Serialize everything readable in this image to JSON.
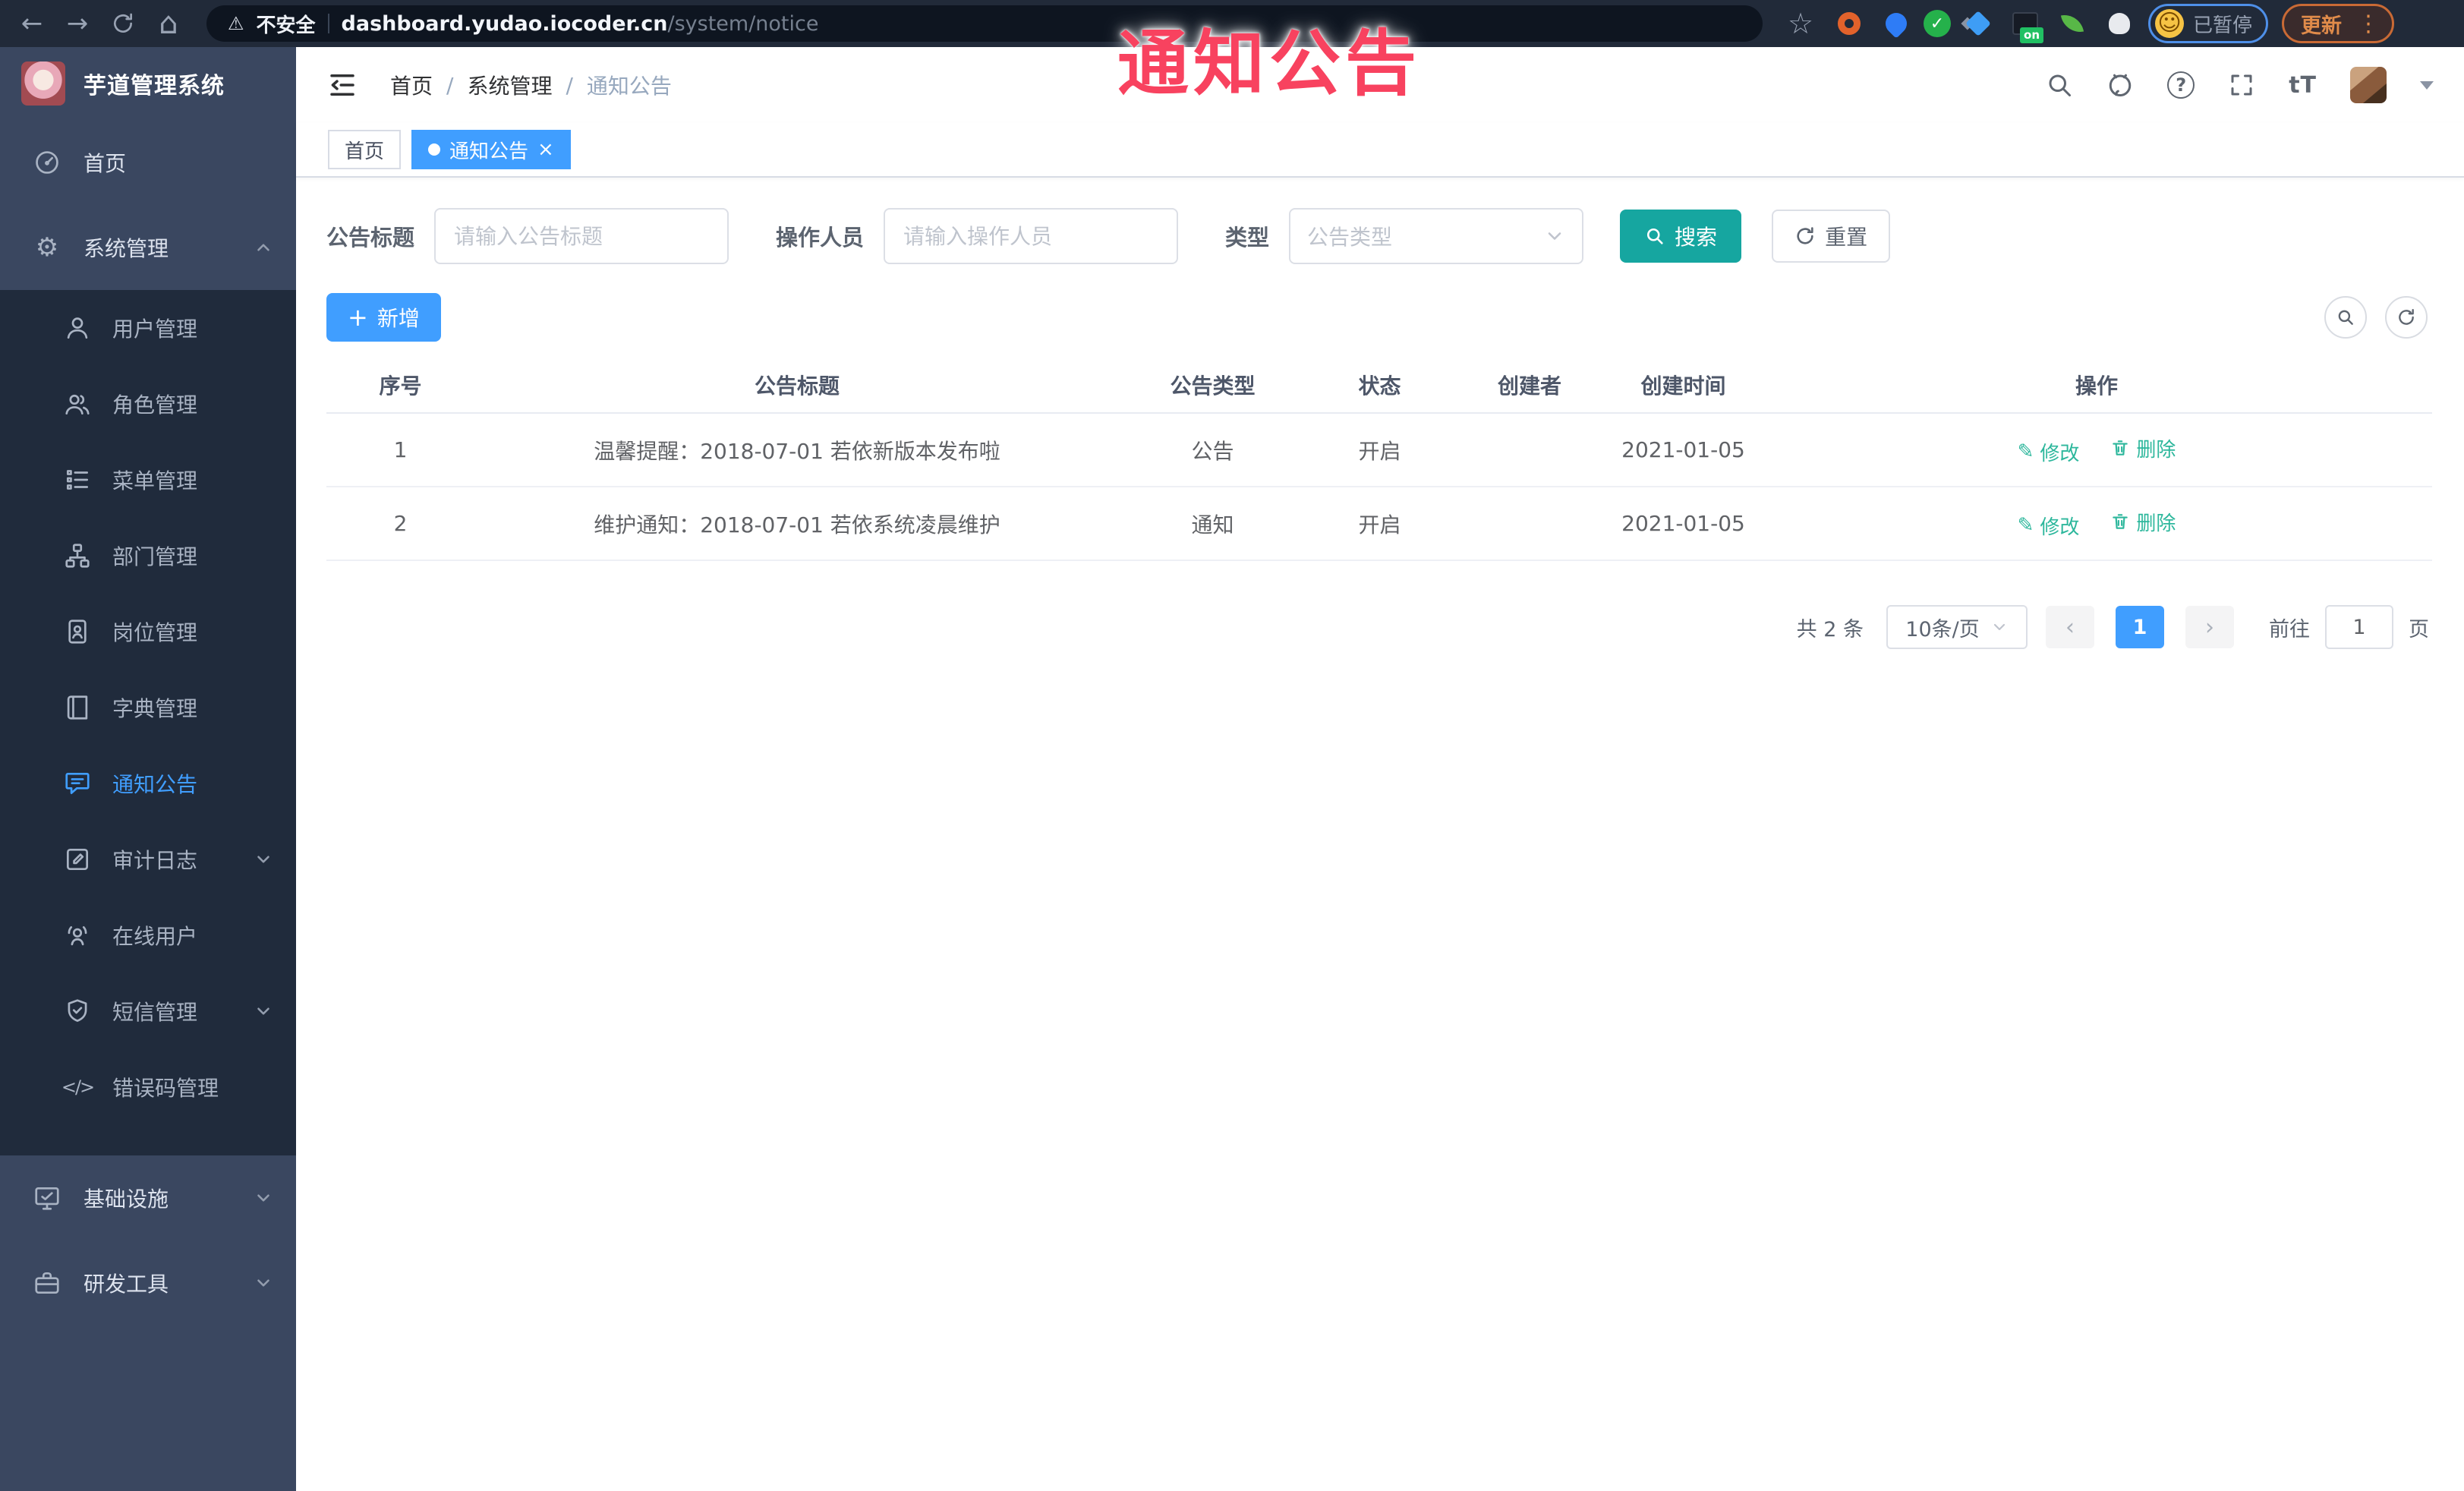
{
  "browser": {
    "security_label": "不安全",
    "url_host": "dashboard.yudao.iocoder.cn",
    "url_path": "/system/notice",
    "paused_badge": "已暂停",
    "update_label": "更新",
    "extension_on_badge": "on"
  },
  "watermark_text": "通知公告",
  "app": {
    "title": "芋道管理系统"
  },
  "sidebar": {
    "items": [
      {
        "label": "首页"
      },
      {
        "label": "系统管理"
      },
      {
        "label": "用户管理"
      },
      {
        "label": "角色管理"
      },
      {
        "label": "菜单管理"
      },
      {
        "label": "部门管理"
      },
      {
        "label": "岗位管理"
      },
      {
        "label": "字典管理"
      },
      {
        "label": "通知公告"
      },
      {
        "label": "审计日志"
      },
      {
        "label": "在线用户"
      },
      {
        "label": "短信管理"
      },
      {
        "label": "错误码管理"
      },
      {
        "label": "基础设施"
      },
      {
        "label": "研发工具"
      }
    ]
  },
  "breadcrumb": {
    "home": "首页",
    "section": "系统管理",
    "current": "通知公告",
    "separator": "/"
  },
  "tabs": {
    "home": "首页",
    "active": "通知公告"
  },
  "filters": {
    "title_label": "公告标题",
    "title_placeholder": "请输入公告标题",
    "operator_label": "操作人员",
    "operator_placeholder": "请输入操作人员",
    "type_label": "类型",
    "type_placeholder": "公告类型",
    "search_label": "搜索",
    "reset_label": "重置"
  },
  "toolbar": {
    "add_label": "新增"
  },
  "table": {
    "columns": [
      "序号",
      "公告标题",
      "公告类型",
      "状态",
      "创建者",
      "创建时间",
      "操作"
    ],
    "rows": [
      {
        "no": "1",
        "title": "温馨提醒：2018-07-01 若依新版本发布啦",
        "type": "公告",
        "status": "开启",
        "creator": "",
        "created_at": "2021-01-05"
      },
      {
        "no": "2",
        "title": "维护通知：2018-07-01 若依系统凌晨维护",
        "type": "通知",
        "status": "开启",
        "creator": "",
        "created_at": "2021-01-05"
      }
    ],
    "edit_label": "修改",
    "delete_label": "删除"
  },
  "pagination": {
    "total_text": "共 2 条",
    "page_size": "10条/页",
    "current_page": "1",
    "goto_label": "前往",
    "goto_value": "1",
    "page_unit": "页"
  },
  "icons": {
    "back": "←",
    "forward": "→",
    "home": "⌂",
    "warning": "⚠",
    "star": "☆",
    "smiley": "☺",
    "dots": "⋮",
    "gear": "⚙",
    "pencil": "✎",
    "code": "</>",
    "plus": "+",
    "close": "×",
    "prev": "‹",
    "next": "›",
    "question": "?",
    "font_size": "tT"
  },
  "colors": {
    "accent_blue": "#409EFF",
    "search_teal": "#16A6A0",
    "action_link": "#2DB79C",
    "watermark_red": "#F8425F",
    "sidebar_bg": "#3A4760",
    "submenu_bg": "#202B3C",
    "browser_bar": "#212A39"
  }
}
